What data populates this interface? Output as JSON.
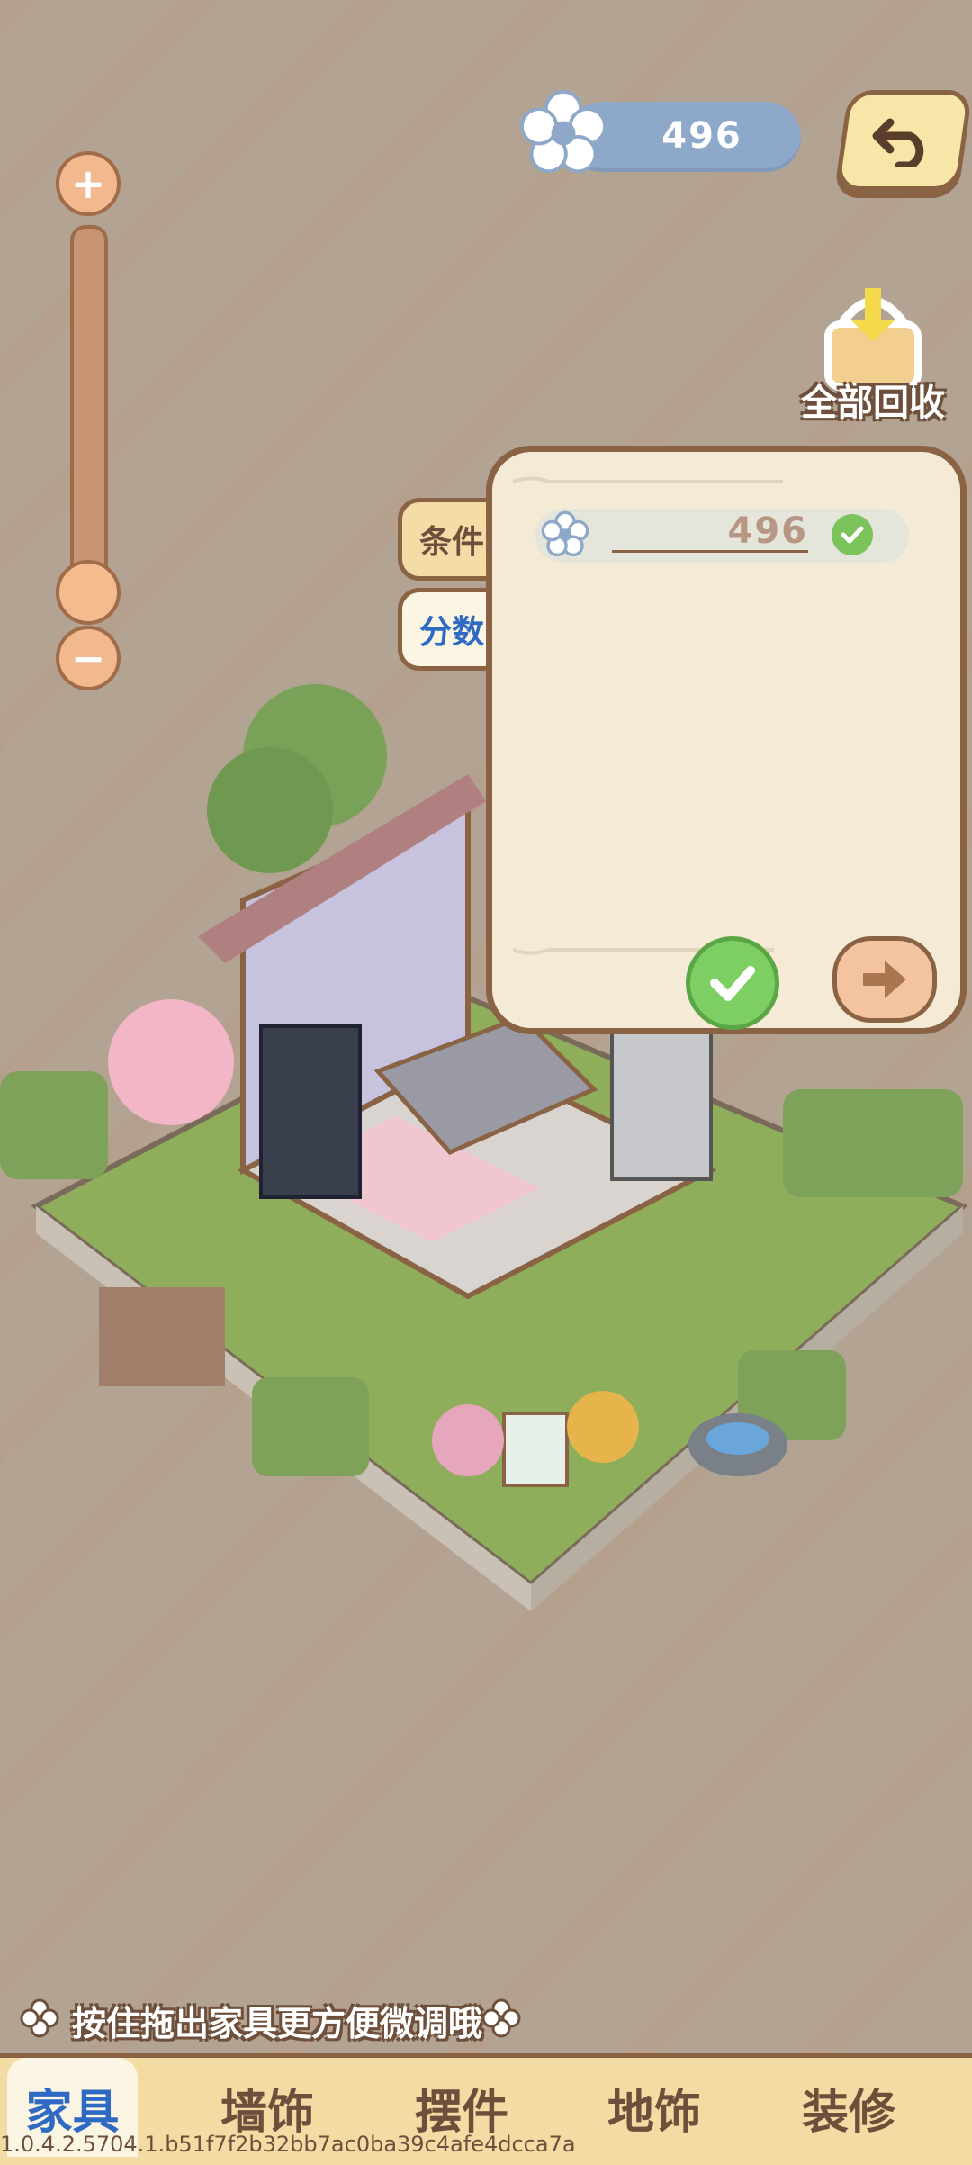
{
  "currency": {
    "value": "496",
    "icon": "flower-icon"
  },
  "top_right": {
    "back_icon": "undo-arrow-icon"
  },
  "recycle_all": {
    "label": "全部回收",
    "icon": "basket-download-icon"
  },
  "zoom": {
    "level": 0.1,
    "plus_icon": "plus-icon",
    "minus_icon": "minus-icon"
  },
  "side_tabs": {
    "conditions": "条件",
    "score": "分数",
    "active": "score"
  },
  "panel": {
    "requirement": {
      "icon": "flower-icon",
      "value": "496",
      "met": true
    },
    "confirm_icon": "checkmark-icon",
    "next_icon": "arrow-right-icon"
  },
  "hint": {
    "text": "按住拖出家具更方便微调哦",
    "icon": "clover-icon"
  },
  "bottom_nav": {
    "tabs": [
      "家具",
      "墙饰",
      "摆件",
      "地饰",
      "装修"
    ],
    "active_index": 0
  },
  "build_id": "1.0.4.2.5704.1.b51f7f2b32bb7ac0ba39c4afe4dcca7a",
  "colors": {
    "accent_blue": "#2e69c3",
    "panel_bg": "#f4ead6",
    "border_brown": "#8a6344",
    "success_green": "#7bc45b",
    "currency_pill": "#8ea8c9"
  }
}
